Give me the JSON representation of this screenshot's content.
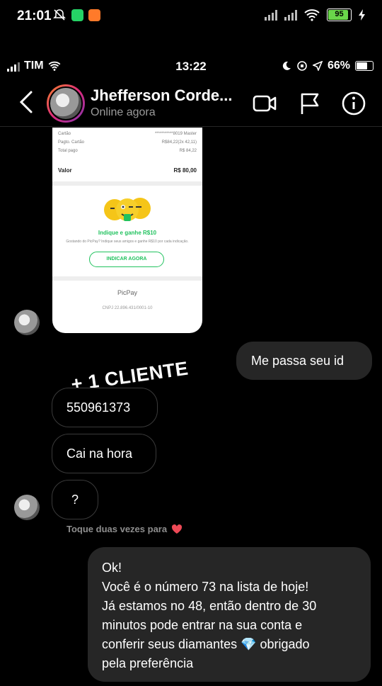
{
  "outer_status": {
    "time": "21:01",
    "battery": "95"
  },
  "ios_status": {
    "carrier": "TIM",
    "time": "13:22",
    "battery": "66%"
  },
  "header": {
    "name": "Jhefferson Corde...",
    "status": "Online agora"
  },
  "receipt": {
    "rows": [
      {
        "label": "Cartão",
        "value": "***********8019 Master"
      },
      {
        "label": "Pagto. Cartão",
        "value": "R$84,22(2x 42,11)"
      },
      {
        "label": "Total pago",
        "value": "R$ 84,22"
      }
    ],
    "valor_label": "Valor",
    "valor_value": "R$ 80,00",
    "indique_title": "Indique e ganhe R$10",
    "indique_desc": "Gostando do PicPay? Indique seus amigos e ganhe R$10 por cada indicação.",
    "button": "INDICAR AGORA",
    "brand": "PicPay",
    "cnpj": "CNPJ 22.896.431/0001-10"
  },
  "messages": {
    "outgoing_1": "Me passa seu id",
    "sticker": "+ 1 CLIENTE",
    "incoming_1": "550961373",
    "incoming_2": "Cai na hora",
    "incoming_3": "?",
    "hint": "Toque duas vezes para",
    "reply_lines": [
      "Ok!",
      "Você é o número 73 na lista de hoje!",
      "Já estamos no 48, então dentro de 30",
      "minutos pode entrar na sua conta e",
      "conferir seus diamantes 💎 obrigado",
      "pela preferência"
    ]
  },
  "colors": {
    "accent_green": "#21c25e",
    "bubble_out": "#262626",
    "heart": "#ed4956"
  }
}
